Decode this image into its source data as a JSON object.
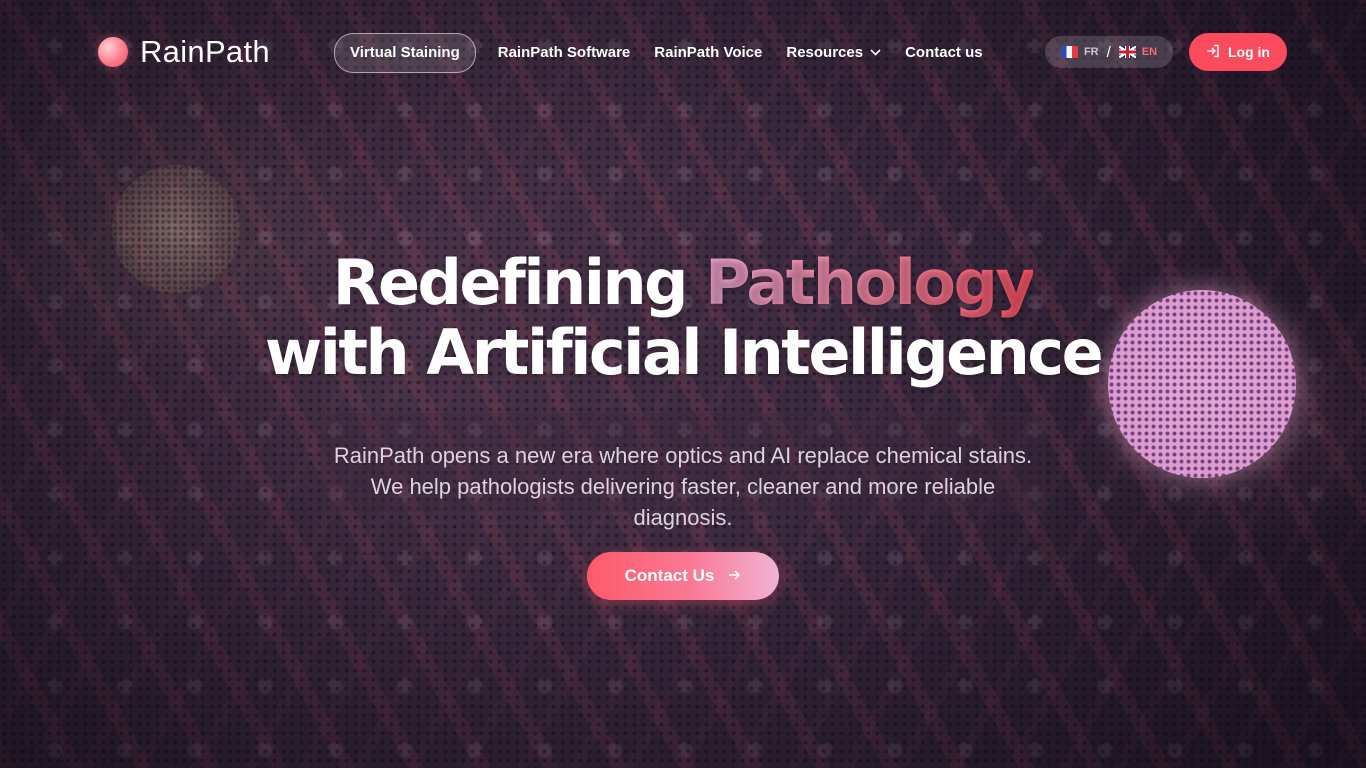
{
  "brand": {
    "name": "RainPath",
    "accent": "#fb4b5c"
  },
  "nav": {
    "items": [
      {
        "label": "Virtual Staining",
        "active": true
      },
      {
        "label": "RainPath Software",
        "active": false
      },
      {
        "label": "RainPath Voice",
        "active": false
      },
      {
        "label": "Resources",
        "active": false,
        "has_dropdown": true
      },
      {
        "label": "Contact us",
        "active": false
      }
    ],
    "dropdown_icon": "chevron-down-icon"
  },
  "language": {
    "options": [
      {
        "code": "FR",
        "flag": "flag-fr-icon",
        "selected": false
      },
      {
        "code": "EN",
        "flag": "flag-uk-icon",
        "selected": true
      }
    ],
    "separator": "/"
  },
  "login": {
    "label": "Log in",
    "icon": "login-icon"
  },
  "hero": {
    "title_part1": "Redefining ",
    "title_highlight": "Pathology",
    "title_line2": "with Artificial Intelligence",
    "subtitle": "RainPath opens a new era where optics and AI replace chemical stains. We help pathologists delivering faster, cleaner and more reliable diagnosis.",
    "cta_label": "Contact Us",
    "cta_icon": "arrow-right-icon"
  }
}
